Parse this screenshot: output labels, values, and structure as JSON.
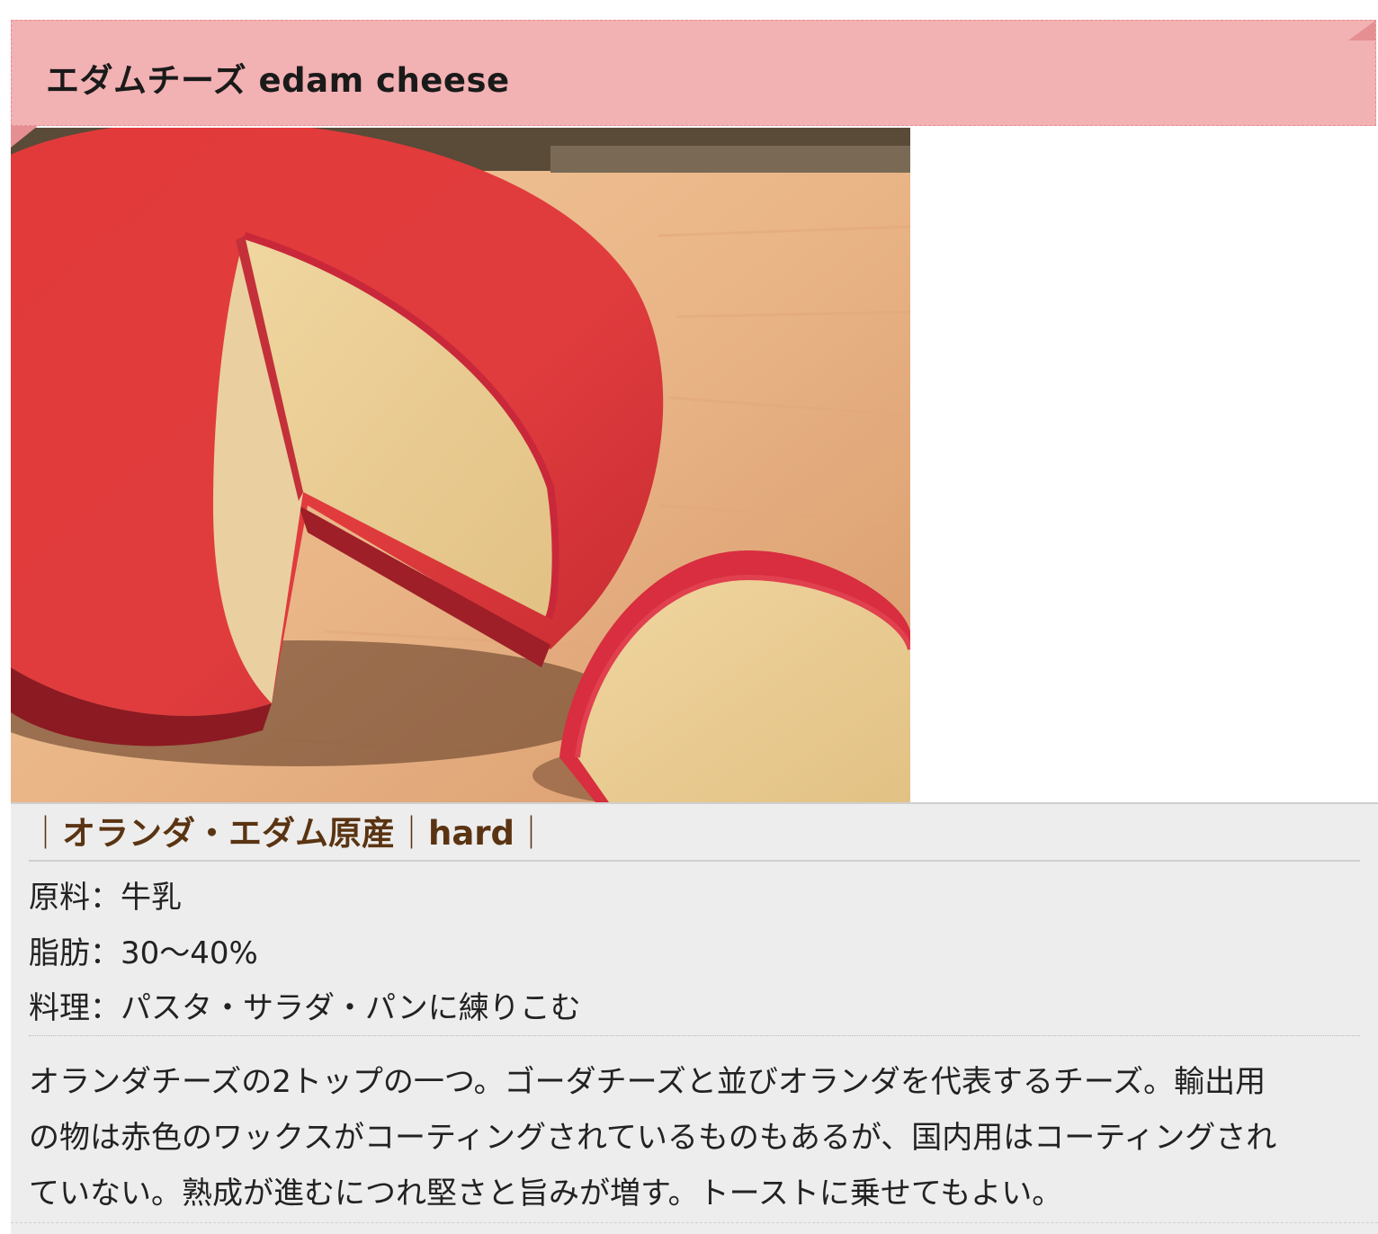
{
  "heading": {
    "title": "エダムチーズ edam cheese"
  },
  "photo": {
    "subject": "edam cheese wheel with red wax"
  },
  "details": {
    "origin_sep1": "｜",
    "origin": "オランダ・エダム原産",
    "origin_sep2": "｜",
    "type": "hard",
    "origin_sep3": "｜",
    "specs": [
      "原料：牛乳",
      "脂肪：30〜40%",
      "料理：パスタ・サラダ・パンに練りこむ"
    ],
    "description_lines": [
      "オランダチーズの2トップの一つ。ゴーダチーズと並びオランダを代表するチーズ。輸出用",
      "の物は赤色のワックスがコーティングされているものもあるが、国内用はコーティングされ",
      "ていない。熟成が進むにつれ堅さと旨みが増す。トーストに乗せてもよい。"
    ]
  },
  "colors": {
    "ribbon": "#f2b1b3",
    "ribbon_border": "#e58f92",
    "info_bg": "#ededed",
    "origin_text": "#5a3412"
  }
}
